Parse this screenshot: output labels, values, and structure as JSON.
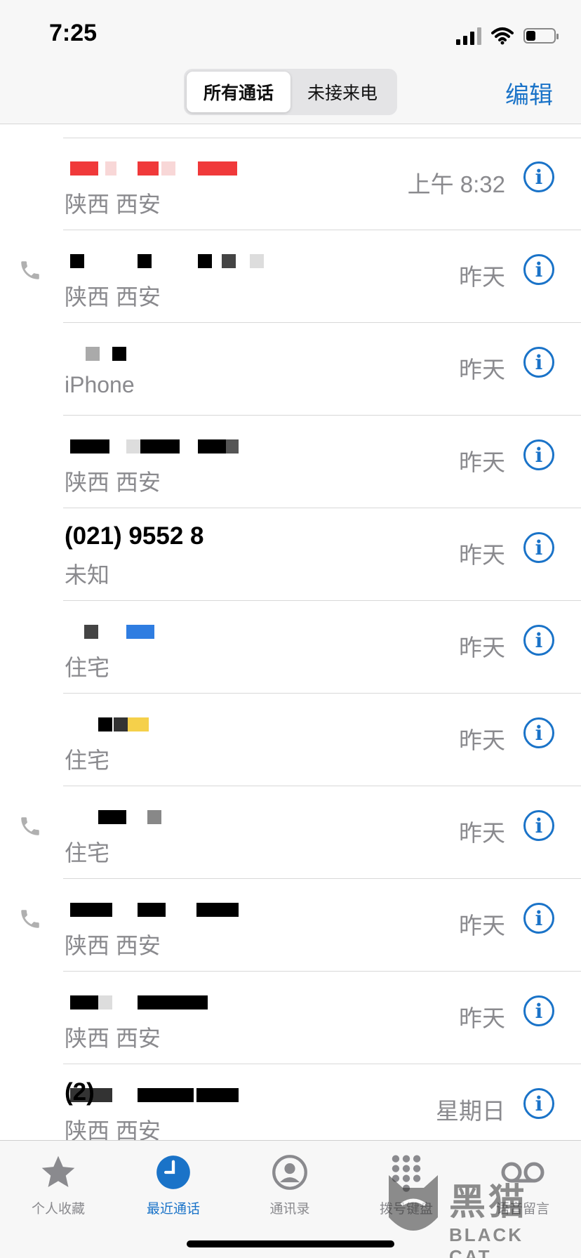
{
  "status_bar": {
    "time": "7:25",
    "battery_level": 0.35
  },
  "header": {
    "segments": [
      {
        "label": "所有通话",
        "active": true
      },
      {
        "label": "未接来电",
        "active": false
      }
    ],
    "edit_label": "编辑"
  },
  "calls": [
    {
      "name": "",
      "subtitle": "陕西 西安",
      "date": "上午 8:32",
      "outgoing": false
    },
    {
      "name": "",
      "subtitle": "陕西 西安",
      "date": "昨天",
      "outgoing": true
    },
    {
      "name": "",
      "subtitle": "iPhone",
      "date": "昨天",
      "outgoing": false
    },
    {
      "name": "",
      "subtitle": "陕西 西安",
      "date": "昨天",
      "outgoing": false
    },
    {
      "name": "(021) 9552 8",
      "subtitle": "未知",
      "date": "昨天",
      "outgoing": false
    },
    {
      "name": "",
      "subtitle": "住宅",
      "date": "昨天",
      "outgoing": false
    },
    {
      "name": "",
      "subtitle": "住宅",
      "date": "昨天",
      "outgoing": false
    },
    {
      "name": "",
      "subtitle": "住宅",
      "date": "昨天",
      "outgoing": true
    },
    {
      "name": "",
      "subtitle": "陕西 西安",
      "date": "昨天",
      "outgoing": true
    },
    {
      "name": "",
      "subtitle": "陕西 西安",
      "date": "昨天",
      "outgoing": false
    },
    {
      "name": "(2)",
      "subtitle": "陕西 西安",
      "date": "星期日",
      "outgoing": false
    }
  ],
  "info_glyph": "i",
  "tabs": [
    {
      "label": "个人收藏",
      "icon": "star-icon",
      "active": false
    },
    {
      "label": "最近通话",
      "icon": "clock-icon",
      "active": true
    },
    {
      "label": "通讯录",
      "icon": "contacts-icon",
      "active": false
    },
    {
      "label": "拨号键盘",
      "icon": "keypad-icon",
      "active": false
    },
    {
      "label": "语音留言",
      "icon": "voicemail-icon",
      "active": false
    }
  ],
  "watermark": {
    "text": "黑猫",
    "sub": "BLACK CAT"
  },
  "colors": {
    "accent": "#1a73c8",
    "secondary_text": "#8a8a8e"
  }
}
